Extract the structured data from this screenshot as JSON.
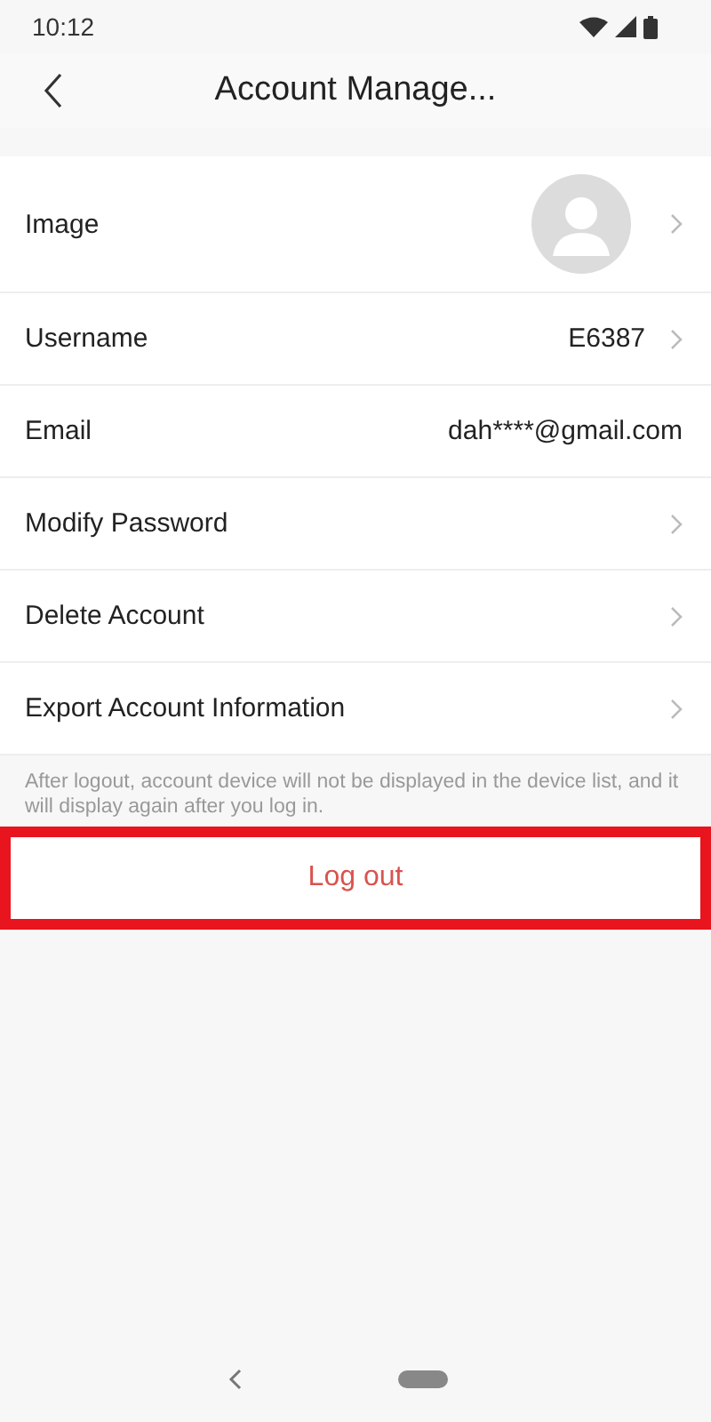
{
  "status_bar": {
    "time": "10:12"
  },
  "header": {
    "title": "Account Manage..."
  },
  "rows": [
    {
      "kind": "avatar",
      "label": "Image",
      "chevron": true
    },
    {
      "kind": "value",
      "label": "Username",
      "value": "E6387",
      "chevron": true
    },
    {
      "kind": "value",
      "label": "Email",
      "value": "dah****@gmail.com",
      "chevron": false
    },
    {
      "kind": "plain",
      "label": "Modify Password",
      "chevron": true
    },
    {
      "kind": "plain",
      "label": "Delete Account",
      "chevron": true
    },
    {
      "kind": "plain",
      "label": "Export Account Information",
      "chevron": true
    }
  ],
  "note": "After logout, account device will not be displayed in the device list, and it will display again after you log in.",
  "logout": {
    "label": "Log out",
    "highlighted": true
  }
}
